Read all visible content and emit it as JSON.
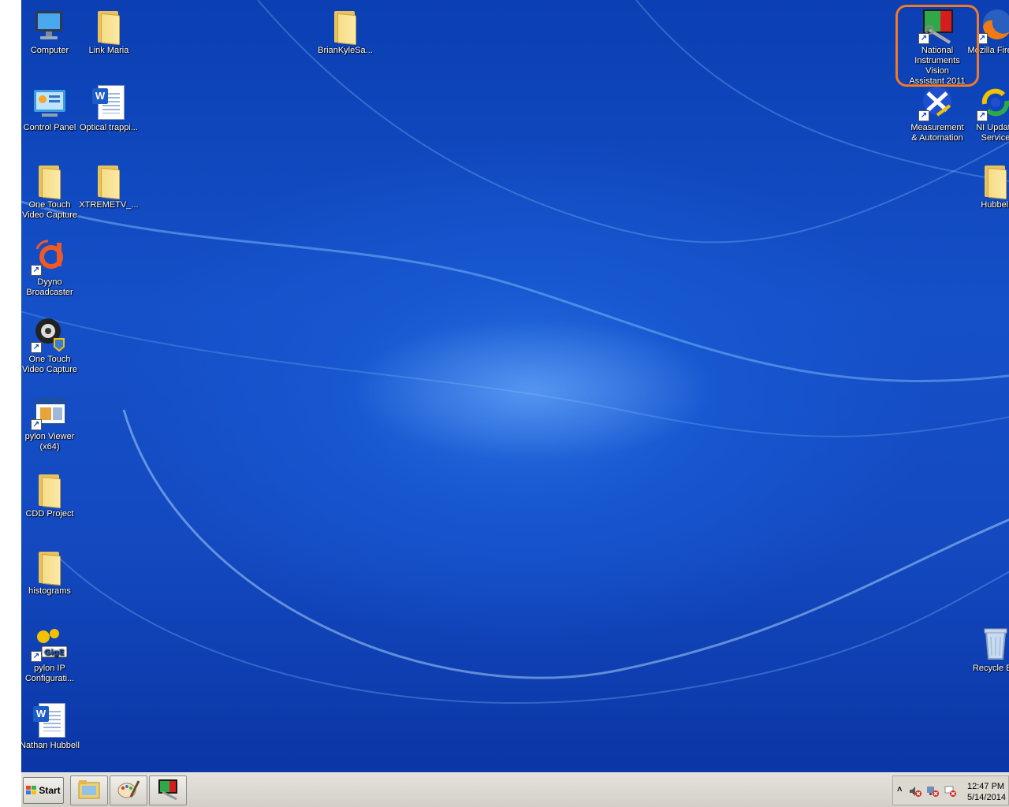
{
  "desktop": {
    "icons": [
      {
        "label": "Computer",
        "icon": "computer-icon"
      },
      {
        "label": "Link Maria",
        "icon": "folder-icon"
      },
      {
        "label": "BrianKyleSa...",
        "icon": "folder-icon"
      },
      {
        "label": "National Instruments Vision Assistant 2011",
        "icon": "ni-vision-assistant-icon"
      },
      {
        "label": "Mozilla Firefox",
        "icon": "firefox-icon"
      },
      {
        "label": "Control Panel",
        "icon": "control-panel-icon"
      },
      {
        "label": "Optical trappi...",
        "icon": "word-document-icon"
      },
      {
        "label": "Measurement & Automation",
        "icon": "ni-max-icon"
      },
      {
        "label": "NI Update Service",
        "icon": "ni-update-icon"
      },
      {
        "label": "One Touch Video Capture",
        "icon": "folder-icon"
      },
      {
        "label": "XTREMETV_...",
        "icon": "folder-icon"
      },
      {
        "label": "Hubbell",
        "icon": "folder-icon"
      },
      {
        "label": "Dyyno Broadcaster",
        "icon": "dyyno-icon"
      },
      {
        "label": "One Touch Video Capture",
        "icon": "webcam-icon"
      },
      {
        "label": "pylon Viewer (x64)",
        "icon": "pylon-viewer-icon"
      },
      {
        "label": "CDD Project",
        "icon": "folder-icon"
      },
      {
        "label": "histograms",
        "icon": "folder-icon"
      },
      {
        "label": "pylon IP Configurati...",
        "icon": "pylon-ip-config-icon"
      },
      {
        "label": "Nathan Hubbell",
        "icon": "word-document-icon"
      },
      {
        "label": "Recycle Bin",
        "icon": "recycle-bin-icon"
      }
    ]
  },
  "taskbar": {
    "start_label": "Start",
    "pinned": [
      {
        "name": "windows-explorer",
        "icon": "explorer-icon"
      },
      {
        "name": "paint",
        "icon": "paint-icon"
      },
      {
        "name": "ni-vision-assistant",
        "icon": "ni-vision-assistant-icon"
      }
    ],
    "tray": {
      "show_hidden_label": "˄",
      "icons": [
        "volume-muted-icon",
        "network-error-icon",
        "action-center-error-icon"
      ],
      "time": "12:47 PM",
      "date": "5/14/2014"
    }
  },
  "colors": {
    "desktop_blue": "#1550c8",
    "highlight_orange": "#f07a27",
    "taskbar_gray": "#d4d0c8"
  }
}
